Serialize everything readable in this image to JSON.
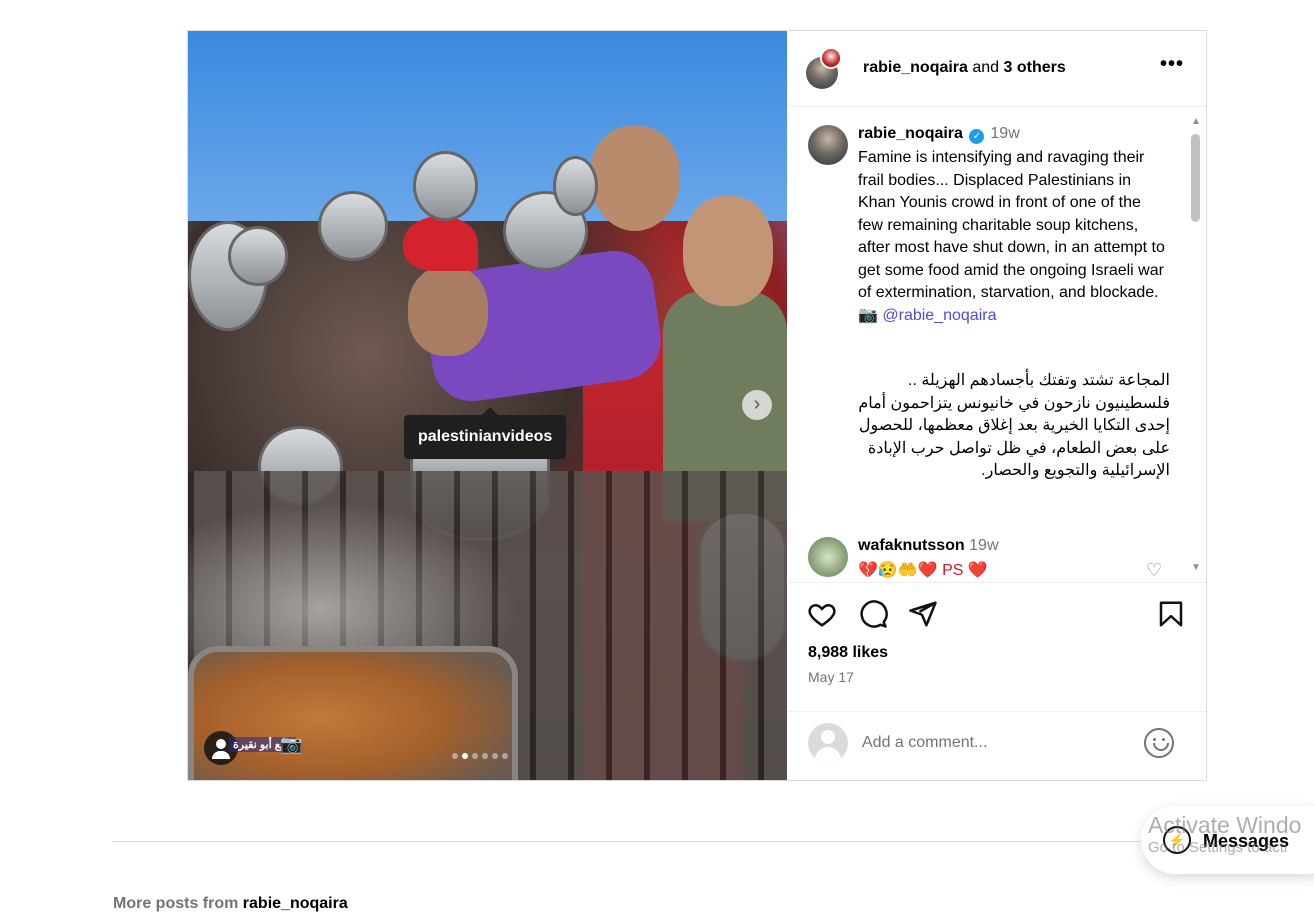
{
  "post": {
    "media": {
      "tooltip_username": "palestinianvideos",
      "watermark_text": "ربيع أبو نقيرة",
      "carousel_dots": 6,
      "active_dot": 1
    },
    "header": {
      "username": "rabie_noqaira",
      "connector": " and ",
      "others": "3 others",
      "more_glyph": "•••"
    },
    "caption": {
      "username": "rabie_noqaira",
      "verified_glyph": "✓",
      "time": "19w",
      "text_en": "Famine is intensifying and ravaging their frail bodies... Displaced Palestinians in Khan Younis crowd in front of one of the few remaining charitable soup kitchens, after most have shut down, in an attempt to get some food amid the ongoing Israeli war of extermination, starvation, and blockade. 📷 ",
      "mention": "@rabie_noqaira",
      "text_ar": "المجاعة تشتد وتفتك بأجسادهم الهزيلة ..\nفلسطينيون نازحون في خانيونس يتزاحمون أمام إحدى التكايا الخيرية بعد إغلاق معظمها، للحصول على بعض الطعام، في ظل تواصل حرب الإبادة الإسرائيلية والتجويع والحصار."
    },
    "comments": [
      {
        "username": "wafaknutsson",
        "time": "19w",
        "text": "💔😥🤲❤️ PS ❤️"
      }
    ],
    "likes": "8,988 likes",
    "date": "May 17",
    "add_comment": {
      "placeholder": "Add a comment..."
    }
  },
  "footer": {
    "more_posts_prefix": "More posts from ",
    "more_posts_user": "rabie_noqaira"
  },
  "messages": {
    "label": "Messages"
  },
  "os_watermark": {
    "title": "Activate Windo",
    "subtitle": "Go to Settings to acti"
  }
}
